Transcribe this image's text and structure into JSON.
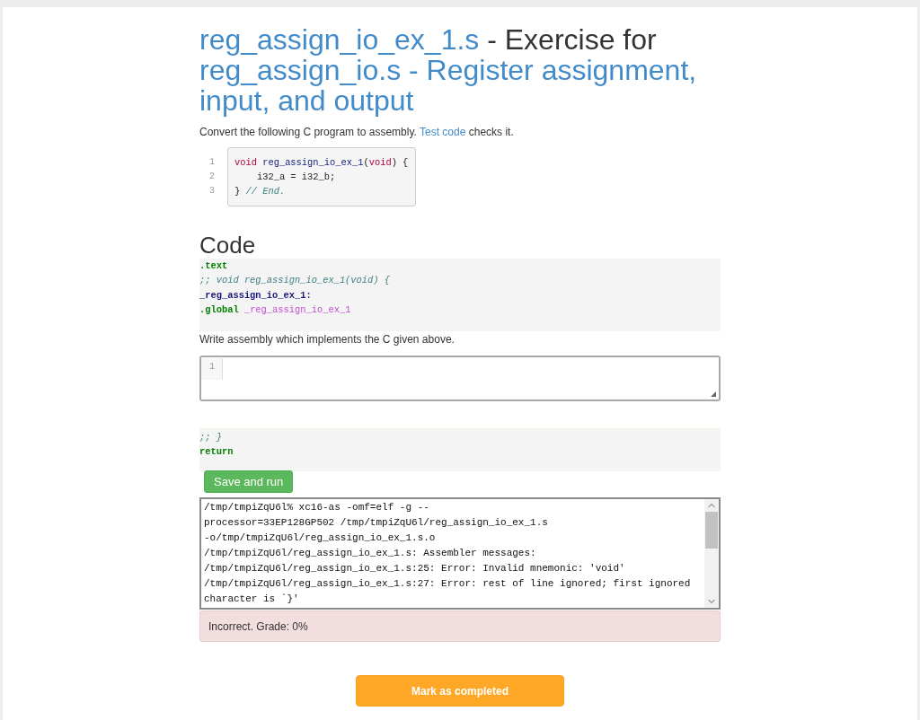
{
  "title": {
    "file_link": "reg_assign_io_ex_1.s",
    "connector": "- Exercise for",
    "parent_link": "reg_assign_io.s - Register assignment, input, and output"
  },
  "intro": {
    "before": "Convert the following C program to assembly.",
    "link": "Test code",
    "after": "checks it."
  },
  "c_program": {
    "lines": [
      {
        "number": "1",
        "tokens": [
          {
            "text": "void",
            "kind": "keyword"
          },
          {
            "text": " reg_assign_io_ex_1",
            "kind": "function"
          },
          {
            "text": "(",
            "kind": "text"
          },
          {
            "text": "void",
            "kind": "keyword"
          },
          {
            "text": ") {",
            "kind": "text"
          }
        ]
      },
      {
        "number": "2",
        "tokens": [
          {
            "text": "    i32_a = i32_b;",
            "kind": "text"
          }
        ]
      },
      {
        "number": "3",
        "tokens": [
          {
            "text": "} ",
            "kind": "text"
          },
          {
            "text": "// End.",
            "kind": "comment"
          }
        ]
      }
    ]
  },
  "code_section": {
    "heading": "Code",
    "prefix_lines": [
      {
        "tokens": [
          {
            "text": ".text",
            "kind": "directive"
          }
        ]
      },
      {
        "tokens": [
          {
            "text": ";; void reg_assign_io_ex_1(void) {",
            "kind": "comment"
          }
        ]
      },
      {
        "tokens": [
          {
            "text": "_reg_assign_io_ex_1:",
            "kind": "label"
          }
        ]
      },
      {
        "tokens": [
          {
            "text": ".global",
            "kind": "directive"
          },
          {
            "text": " _reg_assign_io_ex_1",
            "kind": "symbol"
          }
        ]
      }
    ],
    "instruction": "Write assembly which implements the C given above.",
    "editor": {
      "line_numbers": [
        "1"
      ]
    },
    "suffix_lines": [
      {
        "tokens": [
          {
            "text": ";; }",
            "kind": "comment"
          }
        ]
      },
      {
        "tokens": [
          {
            "text": "return",
            "kind": "directive"
          }
        ]
      }
    ]
  },
  "save_button": "Save and run",
  "output": {
    "lines": [
      "/tmp/tmpiZqU6l% xc16-as -omf=elf -g --",
      "processor=33EP128GP502 /tmp/tmpiZqU6l/reg_assign_io_ex_1.s",
      "-o/tmp/tmpiZqU6l/reg_assign_io_ex_1.s.o",
      "/tmp/tmpiZqU6l/reg_assign_io_ex_1.s: Assembler messages:",
      "/tmp/tmpiZqU6l/reg_assign_io_ex_1.s:25: Error: Invalid mnemonic: 'void'",
      "/tmp/tmpiZqU6l/reg_assign_io_ex_1.s:27: Error: rest of line ignored; first ignored",
      "character is `}'"
    ]
  },
  "feedback": {
    "text": "Incorrect. Grade: 0%",
    "correct": false
  },
  "complete_button": "Mark as completed"
}
